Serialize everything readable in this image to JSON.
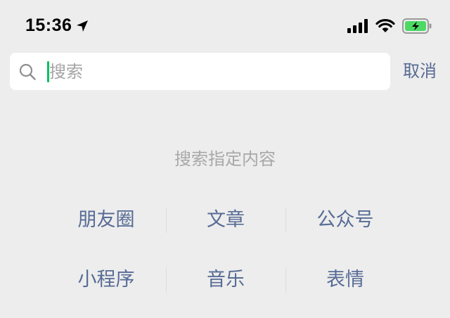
{
  "status_bar": {
    "time": "15:36",
    "icons": [
      "location-arrow-icon",
      "cellular-signal-icon",
      "wifi-icon",
      "battery-charging-icon"
    ],
    "battery_color": "#4cd964"
  },
  "search": {
    "placeholder": "搜索",
    "value": "",
    "caret_color": "#07c160",
    "cancel_label": "取消"
  },
  "hint": {
    "title": "搜索指定内容"
  },
  "categories": [
    {
      "label": "朋友圈"
    },
    {
      "label": "文章"
    },
    {
      "label": "公众号"
    },
    {
      "label": "小程序"
    },
    {
      "label": "音乐"
    },
    {
      "label": "表情"
    }
  ],
  "colors": {
    "background": "#ededed",
    "link": "#576b95",
    "hint_text": "#a8a8a8"
  }
}
